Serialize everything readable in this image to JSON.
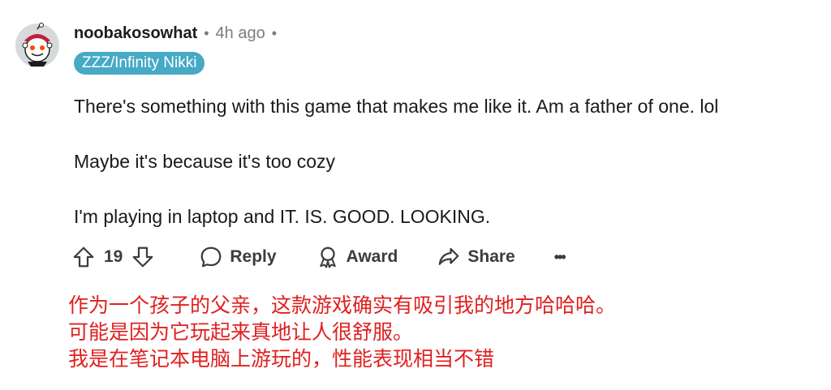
{
  "comment": {
    "username": "noobakosowhat",
    "separator": "•",
    "time": "4h ago",
    "trailing_separator": "•",
    "flair": "ZZZ/Infinity Nikki",
    "paragraphs": [
      "There's something with this game that makes me like it. Am a father of one. lol",
      "Maybe it's because it's too cozy",
      "I'm playing in laptop and IT. IS. GOOD. LOOKING."
    ],
    "actions": {
      "upvote_icon": "arrow-up-icon",
      "vote_count": "19",
      "downvote_icon": "arrow-down-icon",
      "reply_label": "Reply",
      "award_label": "Award",
      "share_label": "Share",
      "more_label": "•••"
    }
  },
  "translation": {
    "lines": [
      "作为一个孩子的父亲，这款游戏确实有吸引我的地方哈哈哈。",
      "可能是因为它玩起来真地让人很舒服。",
      "我是在笔记本电脑上游玩的，性能表现相当不错"
    ],
    "color": "#e02020"
  },
  "colors": {
    "flair_bg": "#46a9c5",
    "text": "#1a1a1b",
    "meta": "#7c7c7c"
  }
}
